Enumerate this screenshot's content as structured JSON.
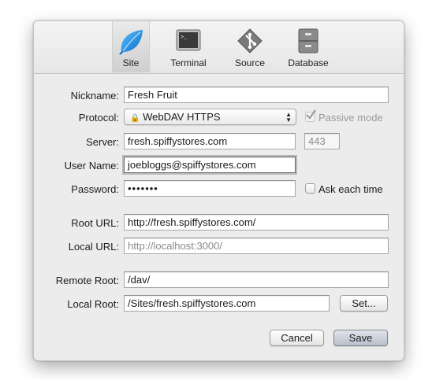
{
  "toolbar": {
    "items": [
      {
        "label": "Site",
        "icon": "leaf-icon",
        "selected": true
      },
      {
        "label": "Terminal",
        "icon": "terminal-icon",
        "selected": false
      },
      {
        "label": "Source",
        "icon": "source-icon",
        "selected": false
      },
      {
        "label": "Database",
        "icon": "database-icon",
        "selected": false
      }
    ]
  },
  "form": {
    "nickname": {
      "label": "Nickname:",
      "value": "Fresh Fruit"
    },
    "protocol": {
      "label": "Protocol:",
      "value": "WebDAV HTTPS",
      "lock_glyph": "🔒"
    },
    "passive_mode": {
      "label": "Passive mode",
      "checked": true,
      "enabled": false
    },
    "server": {
      "label": "Server:",
      "value": "fresh.spiffystores.com",
      "port_placeholder": "443"
    },
    "user_name": {
      "label": "User Name:",
      "value": "joebloggs@spiffystores.com"
    },
    "password": {
      "label": "Password:",
      "masked_value": "•••••••"
    },
    "ask_each_time": {
      "label": "Ask each time",
      "checked": false
    },
    "root_url": {
      "label": "Root URL:",
      "value": "http://fresh.spiffystores.com/"
    },
    "local_url": {
      "label": "Local URL:",
      "placeholder": "http://localhost:3000/"
    },
    "remote_root": {
      "label": "Remote Root:",
      "value": "/dav/"
    },
    "local_root": {
      "label": "Local Root:",
      "value": "/Sites/fresh.spiffystores.com"
    },
    "set_button": "Set..."
  },
  "buttons": {
    "cancel": "Cancel",
    "save": "Save"
  },
  "colors": {
    "window_bg": "#ececec",
    "leaf_blue": "#1e8fe3",
    "default_button": "#c5cbd5"
  }
}
